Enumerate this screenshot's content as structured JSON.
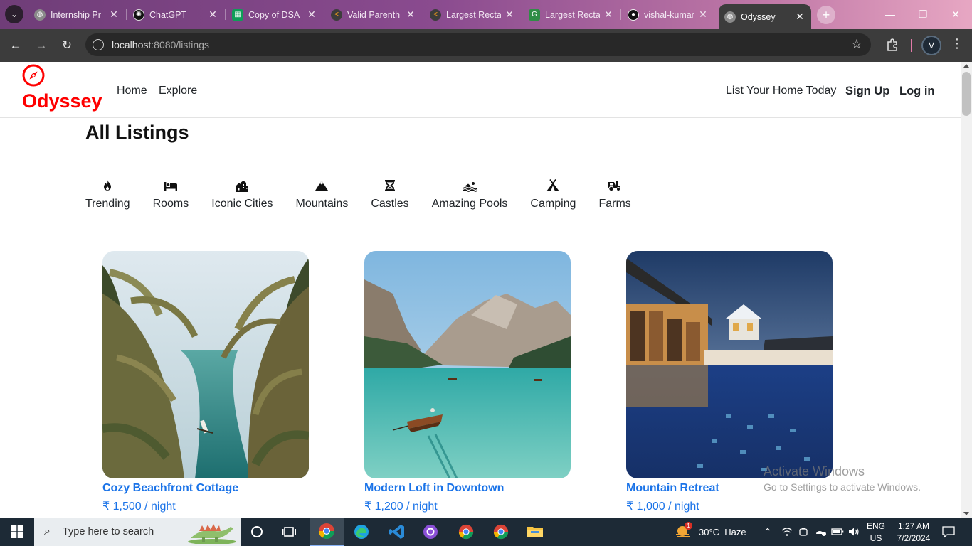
{
  "browser": {
    "tabs": [
      {
        "title": "Internship Pr",
        "icon": "globe-icon",
        "color": "#8a8a8a"
      },
      {
        "title": "ChatGPT",
        "icon": "chatgpt-icon",
        "color": "#111111"
      },
      {
        "title": "Copy of DSA",
        "icon": "sheets-icon",
        "color": "#0f9d58"
      },
      {
        "title": "Valid Parenth",
        "icon": "leetcode-icon",
        "color": "#ffa116"
      },
      {
        "title": "Largest Recta",
        "icon": "leetcode-icon",
        "color": "#ffa116"
      },
      {
        "title": "Largest Recta",
        "icon": "gfg-icon",
        "color": "#2f8d46"
      },
      {
        "title": "vishal-kumar",
        "icon": "github-icon",
        "color": "#111111"
      },
      {
        "title": "Odyssey",
        "icon": "globe-icon",
        "color": "#8a8a8a"
      }
    ],
    "url_host": "localhost",
    "url_path": ":8080/listings",
    "profile_initial": "V"
  },
  "site": {
    "brand": "Odyssey",
    "brand_color": "#fe0000",
    "nav_left": [
      "Home",
      "Explore"
    ],
    "nav_right": {
      "list_home": "List Your Home Today",
      "signup": "Sign Up",
      "login": "Log in"
    }
  },
  "page": {
    "title": "All Listings",
    "filters": [
      {
        "label": "Trending",
        "icon": "fire-icon"
      },
      {
        "label": "Rooms",
        "icon": "bed-icon"
      },
      {
        "label": "Iconic Cities",
        "icon": "city-icon"
      },
      {
        "label": "Mountains",
        "icon": "mountain-icon"
      },
      {
        "label": "Castles",
        "icon": "castle-icon"
      },
      {
        "label": "Amazing Pools",
        "icon": "swimmer-icon"
      },
      {
        "label": "Camping",
        "icon": "tent-icon"
      },
      {
        "label": "Farms",
        "icon": "tractor-icon"
      }
    ],
    "listings": [
      {
        "title": "Cozy Beachfront Cottage",
        "price": "₹ 1,500 / night",
        "image": "tropical-river-palms"
      },
      {
        "title": "Modern Loft in Downtown",
        "price": "₹ 1,200 / night",
        "image": "mountain-lake-boat"
      },
      {
        "title": "Mountain Retreat",
        "price": "₹ 1,000 / night",
        "image": "resort-pool-night"
      }
    ],
    "link_color": "#1a73e8"
  },
  "watermark": {
    "line1": "Activate Windows",
    "line2": "Go to Settings to activate Windows."
  },
  "taskbar": {
    "search_placeholder": "Type here to search",
    "weather": "30°C  Haze",
    "weather_badge": "1",
    "lang": "ENG",
    "region": "US",
    "time": "1:27 AM",
    "date": "7/2/2024"
  }
}
